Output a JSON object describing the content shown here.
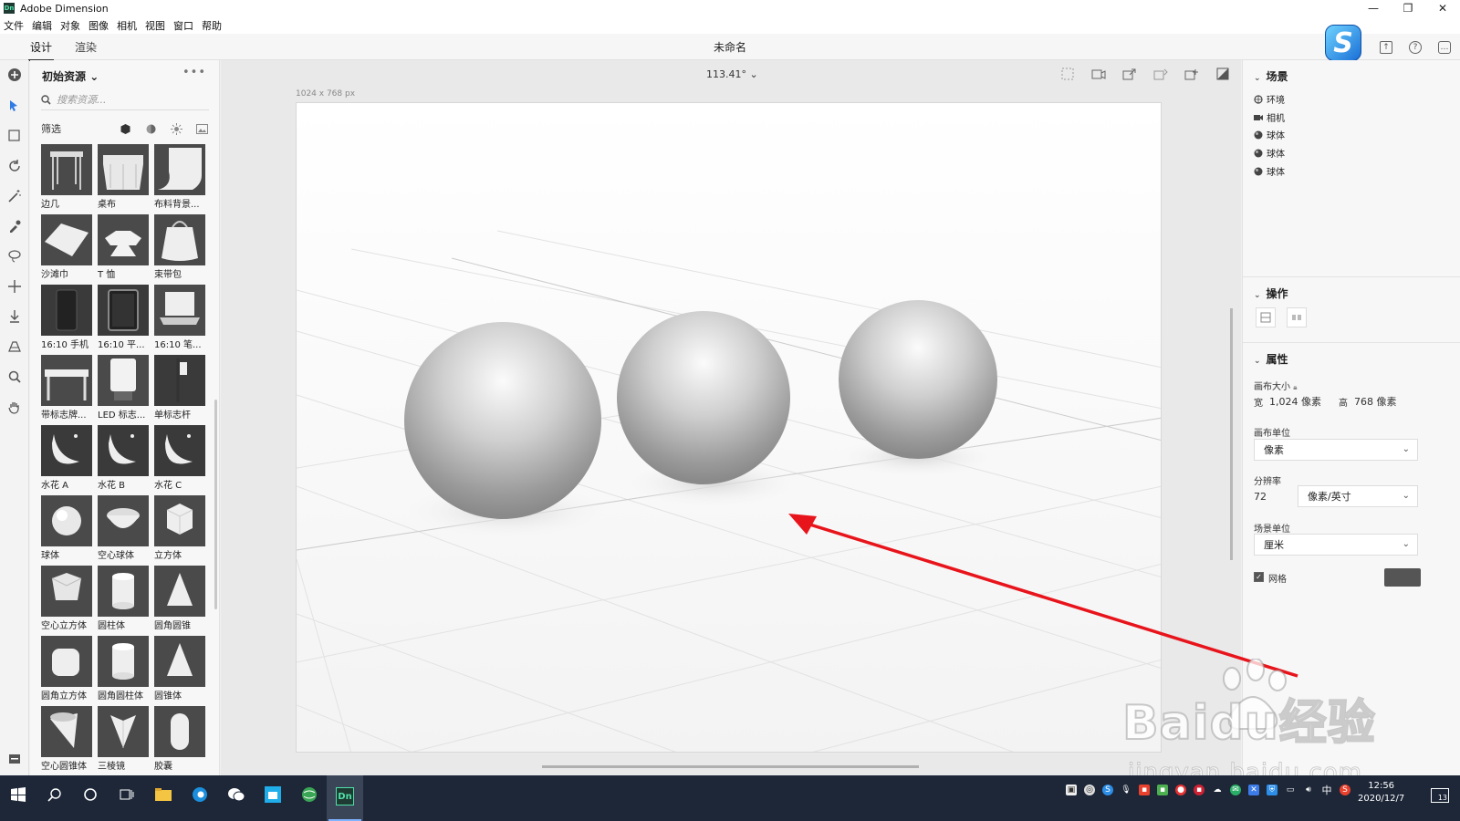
{
  "window": {
    "title": "Adobe Dimension",
    "app_icon": "Dn"
  },
  "menu": [
    "文件",
    "编辑",
    "对象",
    "图像",
    "相机",
    "视图",
    "窗口",
    "帮助"
  ],
  "mode_tabs": [
    {
      "label": "设计",
      "active": true
    },
    {
      "label": "渲染",
      "active": false
    }
  ],
  "document": {
    "title": "未命名"
  },
  "assets": {
    "title": "初始资源",
    "search_placeholder": "搜索资源...",
    "filter_label": "筛选",
    "items": [
      {
        "label": "边几",
        "kind": "table"
      },
      {
        "label": "桌布",
        "kind": "cloth"
      },
      {
        "label": "布料背景...",
        "kind": "backdrop"
      },
      {
        "label": "沙滩巾",
        "kind": "towel"
      },
      {
        "label": "T 恤",
        "kind": "tshirt"
      },
      {
        "label": "束带包",
        "kind": "bag"
      },
      {
        "label": "16:10 手机",
        "kind": "phone"
      },
      {
        "label": "16:10 平...",
        "kind": "tablet"
      },
      {
        "label": "16:10 笔...",
        "kind": "laptop"
      },
      {
        "label": "带标志牌...",
        "kind": "sign"
      },
      {
        "label": "LED 标志...",
        "kind": "led"
      },
      {
        "label": "单标志杆",
        "kind": "pole"
      },
      {
        "label": "水花 A",
        "kind": "splash"
      },
      {
        "label": "水花 B",
        "kind": "splash"
      },
      {
        "label": "水花 C",
        "kind": "splash"
      },
      {
        "label": "球体",
        "kind": "sphere"
      },
      {
        "label": "空心球体",
        "kind": "bowl"
      },
      {
        "label": "立方体",
        "kind": "cube"
      },
      {
        "label": "空心立方体",
        "kind": "hollow-cube"
      },
      {
        "label": "圆柱体",
        "kind": "cylinder"
      },
      {
        "label": "圆角圆锥",
        "kind": "cone"
      },
      {
        "label": "圆角立方体",
        "kind": "round-cube"
      },
      {
        "label": "圆角圆柱体",
        "kind": "cylinder"
      },
      {
        "label": "圆锥体",
        "kind": "cone"
      },
      {
        "label": "空心圆锥体",
        "kind": "hollow-cone"
      },
      {
        "label": "三棱镜",
        "kind": "prism"
      },
      {
        "label": "胶囊",
        "kind": "capsule"
      }
    ]
  },
  "viewport": {
    "zoom": "113.41°",
    "canvas_dims": "1024 x 768 px"
  },
  "scene": {
    "title": "场景",
    "items": [
      {
        "label": "环境",
        "icon": "environment-icon"
      },
      {
        "label": "相机",
        "icon": "camera-icon"
      },
      {
        "label": "球体",
        "icon": "sphere-icon"
      },
      {
        "label": "球体",
        "icon": "sphere-icon"
      },
      {
        "label": "球体",
        "icon": "sphere-icon"
      }
    ]
  },
  "actions": {
    "title": "操作"
  },
  "properties": {
    "title": "属性",
    "canvas_size_label": "画布大小",
    "width_label": "宽",
    "width_value": "1,024 像素",
    "height_label": "高",
    "height_value": "768 像素",
    "canvas_unit_label": "画布单位",
    "canvas_unit_value": "像素",
    "resolution_label": "分辨率",
    "resolution_value": "72",
    "resolution_unit": "像素/英寸",
    "scene_unit_label": "场景单位",
    "scene_unit_value": "厘米",
    "grid_label": "网格",
    "grid_checked": true,
    "grid_color": "#555555"
  },
  "taskbar": {
    "time": "12:56",
    "date": "2020/12/7",
    "ime": "中",
    "notifications": "13"
  },
  "watermark": {
    "main": "Baidu经验",
    "sub": "jingyan.baidu.com"
  },
  "colors": {
    "accent": "#7fb3ff",
    "annotation_arrow": "#e8141b",
    "taskbar": "#1d2738"
  }
}
